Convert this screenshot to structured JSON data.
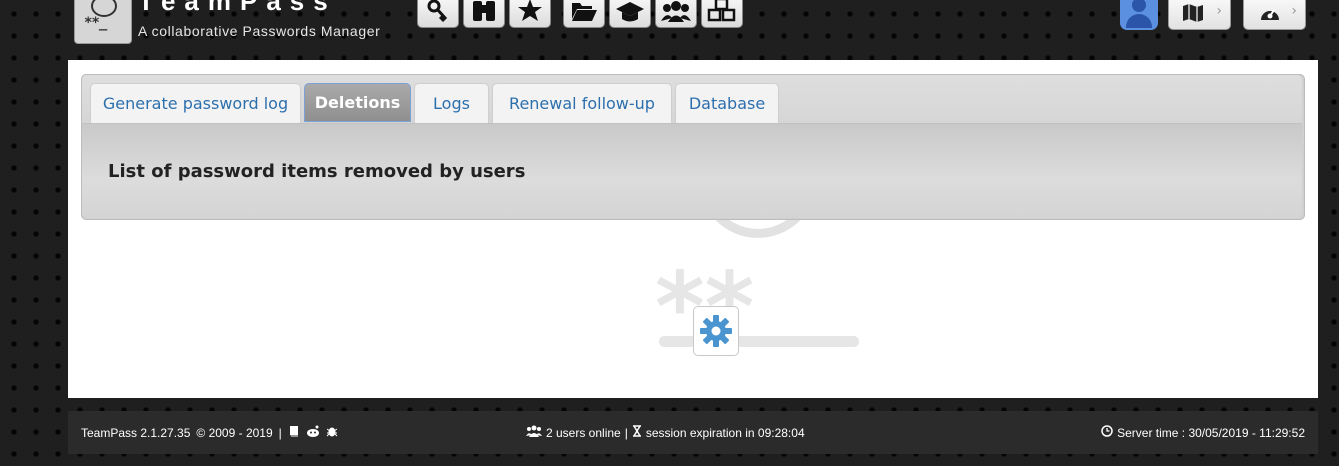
{
  "header": {
    "app_title": "TeamPass",
    "app_subtitle": "A collaborative Passwords Manager",
    "nav_icons": [
      "key-icon",
      "binoculars-icon",
      "star-icon",
      "folder-open-icon",
      "graduation-cap-icon",
      "users-icon",
      "cubes-icon"
    ],
    "right_icons": [
      "user-avatar-icon",
      "map-icon",
      "dashboard-icon"
    ]
  },
  "tabs": [
    {
      "label": "Generate password log",
      "active": false
    },
    {
      "label": "Deletions",
      "active": true
    },
    {
      "label": "Logs",
      "active": false
    },
    {
      "label": "Renewal follow-up",
      "active": false
    },
    {
      "label": "Database",
      "active": false
    }
  ],
  "content": {
    "heading": "List of password items removed by users"
  },
  "footer": {
    "version": "TeamPass 2.1.27.35",
    "copyright": "© 2009 - 2019",
    "separator": "|",
    "users_online": "2 users online",
    "session_expiration": "session expiration in 09:28:04",
    "server_time": "Server time : 30/05/2019 - 11:29:52"
  },
  "colors": {
    "tab_text": "#2c6fad",
    "active_tab_border": "#7aa2d6",
    "spinner": "#4a94d0",
    "user_avatar": "#5b8fe0"
  }
}
